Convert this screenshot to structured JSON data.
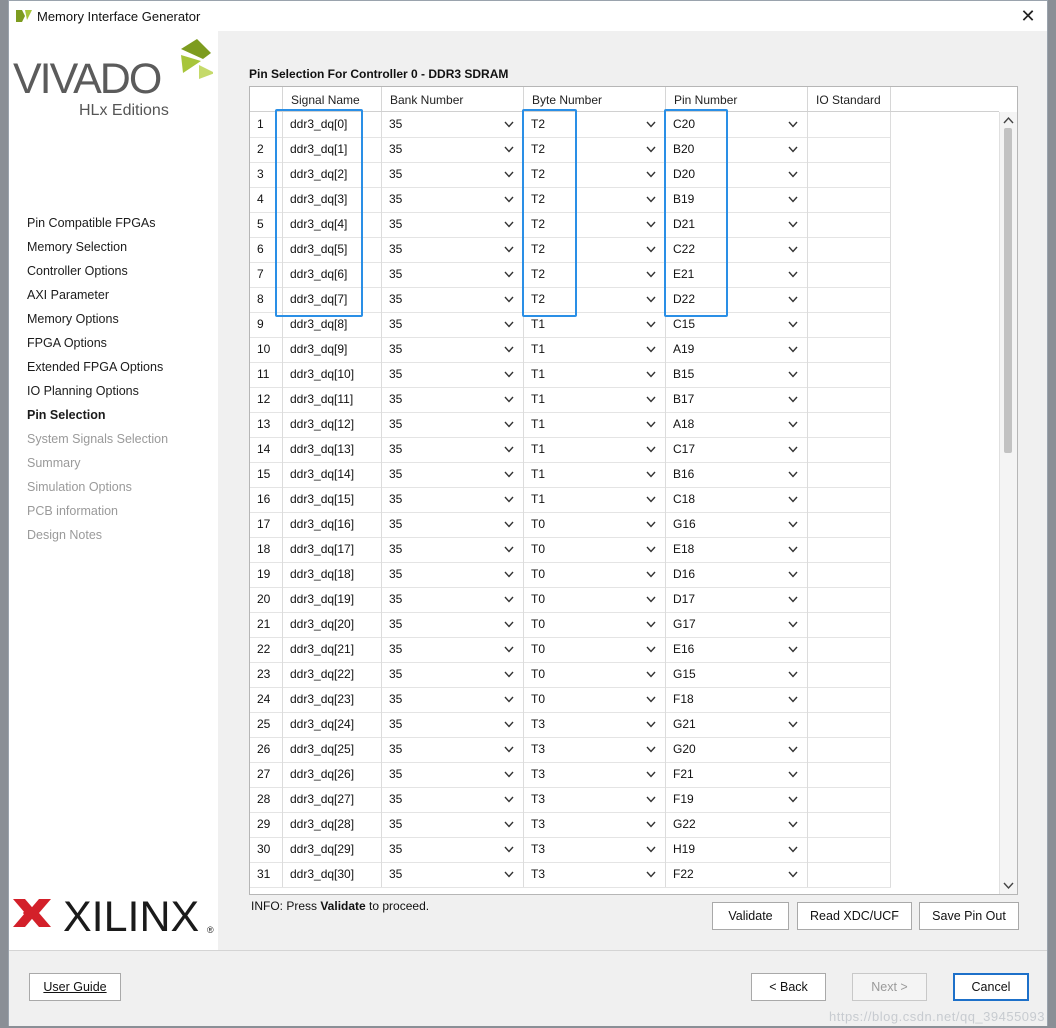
{
  "window": {
    "title": "Memory Interface Generator",
    "close_icon": "close-icon"
  },
  "logos": {
    "vivado_text": "VIVADO",
    "vivado_sub": "HLx Editions",
    "xilinx_text": "XILINX"
  },
  "steps": [
    {
      "label": "Pin Compatible FPGAs",
      "state": "normal"
    },
    {
      "label": "Memory Selection",
      "state": "normal"
    },
    {
      "label": "Controller Options",
      "state": "normal"
    },
    {
      "label": "AXI Parameter",
      "state": "normal"
    },
    {
      "label": "Memory Options",
      "state": "normal"
    },
    {
      "label": "FPGA Options",
      "state": "normal"
    },
    {
      "label": "Extended FPGA Options",
      "state": "normal"
    },
    {
      "label": "IO Planning Options",
      "state": "normal"
    },
    {
      "label": "Pin Selection",
      "state": "active"
    },
    {
      "label": "System Signals Selection",
      "state": "disabled"
    },
    {
      "label": "Summary",
      "state": "disabled"
    },
    {
      "label": "Simulation Options",
      "state": "disabled"
    },
    {
      "label": "PCB information",
      "state": "disabled"
    },
    {
      "label": "Design Notes",
      "state": "disabled"
    }
  ],
  "main": {
    "section_title": "Pin Selection For Controller 0 - DDR3 SDRAM",
    "columns": [
      "Signal Name",
      "Bank Number",
      "Byte Number",
      "Pin Number",
      "IO Standard"
    ],
    "rows": [
      {
        "idx": "1",
        "signal": "ddr3_dq[0]",
        "bank": "35",
        "byte": "T2",
        "pin": "C20",
        "io": ""
      },
      {
        "idx": "2",
        "signal": "ddr3_dq[1]",
        "bank": "35",
        "byte": "T2",
        "pin": "B20",
        "io": ""
      },
      {
        "idx": "3",
        "signal": "ddr3_dq[2]",
        "bank": "35",
        "byte": "T2",
        "pin": "D20",
        "io": ""
      },
      {
        "idx": "4",
        "signal": "ddr3_dq[3]",
        "bank": "35",
        "byte": "T2",
        "pin": "B19",
        "io": ""
      },
      {
        "idx": "5",
        "signal": "ddr3_dq[4]",
        "bank": "35",
        "byte": "T2",
        "pin": "D21",
        "io": ""
      },
      {
        "idx": "6",
        "signal": "ddr3_dq[5]",
        "bank": "35",
        "byte": "T2",
        "pin": "C22",
        "io": ""
      },
      {
        "idx": "7",
        "signal": "ddr3_dq[6]",
        "bank": "35",
        "byte": "T2",
        "pin": "E21",
        "io": ""
      },
      {
        "idx": "8",
        "signal": "ddr3_dq[7]",
        "bank": "35",
        "byte": "T2",
        "pin": "D22",
        "io": ""
      },
      {
        "idx": "9",
        "signal": "ddr3_dq[8]",
        "bank": "35",
        "byte": "T1",
        "pin": "C15",
        "io": ""
      },
      {
        "idx": "10",
        "signal": "ddr3_dq[9]",
        "bank": "35",
        "byte": "T1",
        "pin": "A19",
        "io": ""
      },
      {
        "idx": "11",
        "signal": "ddr3_dq[10]",
        "bank": "35",
        "byte": "T1",
        "pin": "B15",
        "io": ""
      },
      {
        "idx": "12",
        "signal": "ddr3_dq[11]",
        "bank": "35",
        "byte": "T1",
        "pin": "B17",
        "io": ""
      },
      {
        "idx": "13",
        "signal": "ddr3_dq[12]",
        "bank": "35",
        "byte": "T1",
        "pin": "A18",
        "io": ""
      },
      {
        "idx": "14",
        "signal": "ddr3_dq[13]",
        "bank": "35",
        "byte": "T1",
        "pin": "C17",
        "io": ""
      },
      {
        "idx": "15",
        "signal": "ddr3_dq[14]",
        "bank": "35",
        "byte": "T1",
        "pin": "B16",
        "io": ""
      },
      {
        "idx": "16",
        "signal": "ddr3_dq[15]",
        "bank": "35",
        "byte": "T1",
        "pin": "C18",
        "io": ""
      },
      {
        "idx": "17",
        "signal": "ddr3_dq[16]",
        "bank": "35",
        "byte": "T0",
        "pin": "G16",
        "io": ""
      },
      {
        "idx": "18",
        "signal": "ddr3_dq[17]",
        "bank": "35",
        "byte": "T0",
        "pin": "E18",
        "io": ""
      },
      {
        "idx": "19",
        "signal": "ddr3_dq[18]",
        "bank": "35",
        "byte": "T0",
        "pin": "D16",
        "io": ""
      },
      {
        "idx": "20",
        "signal": "ddr3_dq[19]",
        "bank": "35",
        "byte": "T0",
        "pin": "D17",
        "io": ""
      },
      {
        "idx": "21",
        "signal": "ddr3_dq[20]",
        "bank": "35",
        "byte": "T0",
        "pin": "G17",
        "io": ""
      },
      {
        "idx": "22",
        "signal": "ddr3_dq[21]",
        "bank": "35",
        "byte": "T0",
        "pin": "E16",
        "io": ""
      },
      {
        "idx": "23",
        "signal": "ddr3_dq[22]",
        "bank": "35",
        "byte": "T0",
        "pin": "G15",
        "io": ""
      },
      {
        "idx": "24",
        "signal": "ddr3_dq[23]",
        "bank": "35",
        "byte": "T0",
        "pin": "F18",
        "io": ""
      },
      {
        "idx": "25",
        "signal": "ddr3_dq[24]",
        "bank": "35",
        "byte": "T3",
        "pin": "G21",
        "io": ""
      },
      {
        "idx": "26",
        "signal": "ddr3_dq[25]",
        "bank": "35",
        "byte": "T3",
        "pin": "G20",
        "io": ""
      },
      {
        "idx": "27",
        "signal": "ddr3_dq[26]",
        "bank": "35",
        "byte": "T3",
        "pin": "F21",
        "io": ""
      },
      {
        "idx": "28",
        "signal": "ddr3_dq[27]",
        "bank": "35",
        "byte": "T3",
        "pin": "F19",
        "io": ""
      },
      {
        "idx": "29",
        "signal": "ddr3_dq[28]",
        "bank": "35",
        "byte": "T3",
        "pin": "G22",
        "io": ""
      },
      {
        "idx": "30",
        "signal": "ddr3_dq[29]",
        "bank": "35",
        "byte": "T3",
        "pin": "H19",
        "io": ""
      },
      {
        "idx": "31",
        "signal": "ddr3_dq[30]",
        "bank": "35",
        "byte": "T3",
        "pin": "F22",
        "io": ""
      }
    ],
    "info_prefix": "INFO: Press ",
    "info_bold": "Validate",
    "info_suffix": " to proceed.",
    "buttons": {
      "validate": "Validate",
      "read_xdc": "Read XDC/UCF",
      "save_pin": "Save Pin Out"
    }
  },
  "footer": {
    "user_guide": "User Guide",
    "back": "< Back",
    "next": "Next >",
    "cancel": "Cancel"
  },
  "watermark": "https://blog.csdn.net/qq_39455093",
  "colors": {
    "highlight": "#2a8fe6",
    "accent": "#1d70c9"
  }
}
